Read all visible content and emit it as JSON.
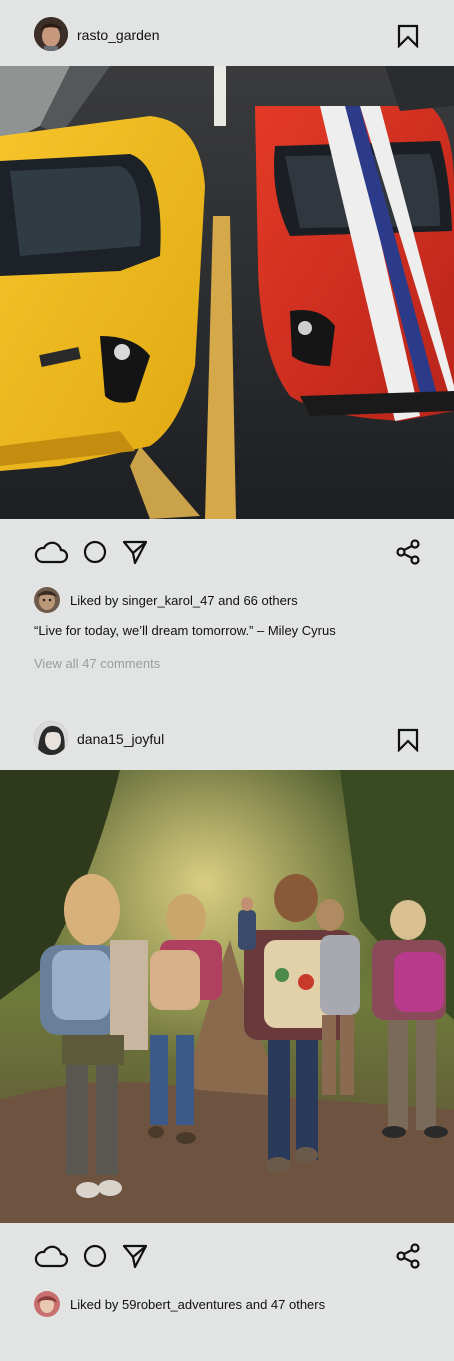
{
  "posts": [
    {
      "username": "rasto_garden",
      "avatar_icon": "profile-avatar",
      "bookmark_icon": "bookmark-icon",
      "photo_description": "yellow and red sports cars",
      "actions": [
        "cloud-icon",
        "comment-icon",
        "send-icon",
        "share-icon"
      ],
      "likes": {
        "text": "Liked by singer_karol_47 and 66 others"
      },
      "caption": "“Live for today, we’ll dream tomorrow.” – Miley Cyrus",
      "comments_link": "View all 47 comments"
    },
    {
      "username": "dana15_joyful",
      "avatar_icon": "profile-avatar",
      "bookmark_icon": "bookmark-icon",
      "photo_description": "children hiking on a forest trail",
      "actions": [
        "cloud-icon",
        "comment-icon",
        "send-icon",
        "share-icon"
      ],
      "likes": {
        "text": "Liked by 59robert_adventures and 47 others"
      }
    }
  ],
  "colors": {
    "background": "#e1e4e3",
    "text": "#111111",
    "muted": "#9a9d9d"
  }
}
